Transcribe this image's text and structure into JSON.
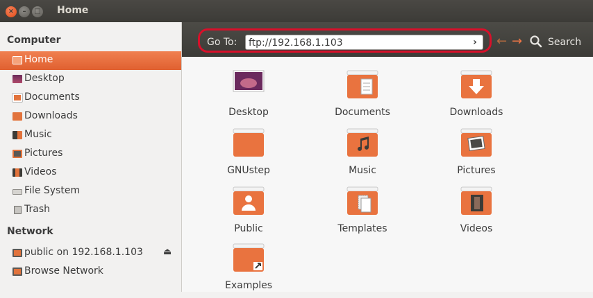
{
  "window": {
    "title": "Home",
    "close_glyph": "×",
    "min_glyph": "–",
    "max_glyph": "□"
  },
  "sidebar": {
    "sections": [
      {
        "title": "Computer"
      },
      {
        "title": "Network"
      }
    ],
    "computer_items": [
      {
        "label": "Home",
        "icon": "home-folder-icon",
        "active": true
      },
      {
        "label": "Desktop",
        "icon": "desktop-icon"
      },
      {
        "label": "Documents",
        "icon": "documents-icon"
      },
      {
        "label": "Downloads",
        "icon": "downloads-icon"
      },
      {
        "label": "Music",
        "icon": "music-icon"
      },
      {
        "label": "Pictures",
        "icon": "pictures-icon"
      },
      {
        "label": "Videos",
        "icon": "videos-icon"
      },
      {
        "label": "File System",
        "icon": "drive-icon"
      },
      {
        "label": "Trash",
        "icon": "trash-icon"
      }
    ],
    "network_items": [
      {
        "label": "public on 192.168.1.103",
        "icon": "network-share-icon",
        "eject": "⏏"
      },
      {
        "label": "Browse Network",
        "icon": "network-icon"
      }
    ]
  },
  "toolbar": {
    "goto_label": "Go To:",
    "goto_value": "ftp://192.168.1.103",
    "go_glyph": "›",
    "back_glyph": "←",
    "forward_glyph": "→",
    "search_label": "Search"
  },
  "files": [
    {
      "label": "Desktop",
      "icon": "desktop-folder-icon"
    },
    {
      "label": "Documents",
      "icon": "documents-folder-icon"
    },
    {
      "label": "Downloads",
      "icon": "downloads-folder-icon"
    },
    {
      "label": "GNUstep",
      "icon": "folder-icon"
    },
    {
      "label": "Music",
      "icon": "music-folder-icon"
    },
    {
      "label": "Pictures",
      "icon": "pictures-folder-icon"
    },
    {
      "label": "Public",
      "icon": "public-folder-icon"
    },
    {
      "label": "Templates",
      "icon": "templates-folder-icon"
    },
    {
      "label": "Videos",
      "icon": "videos-folder-icon"
    },
    {
      "label": "Examples",
      "icon": "examples-folder-icon"
    }
  ],
  "colors": {
    "accent": "#e95420",
    "titlebar": "#3c3b37",
    "highlight_ring": "#d8102a"
  }
}
